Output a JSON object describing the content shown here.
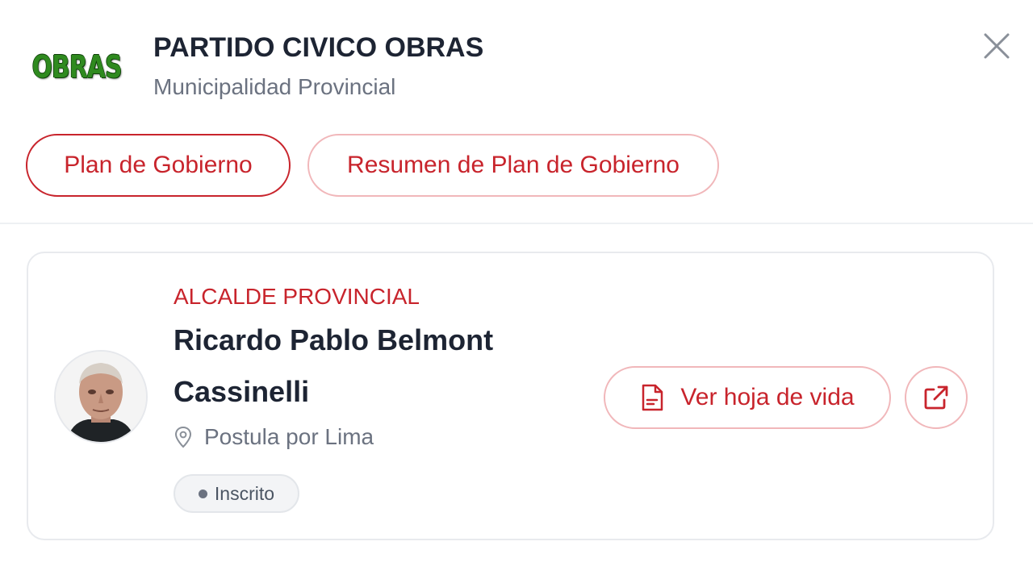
{
  "party": {
    "logo_text": "OBRAS",
    "name": "PARTIDO CIVICO OBRAS",
    "subtitle": "Municipalidad Provincial"
  },
  "actions": {
    "plan_label": "Plan de Gobierno",
    "summary_label": "Resumen de Plan de Gobierno"
  },
  "candidate": {
    "role": "ALCALDE PROVINCIAL",
    "name": "Ricardo Pablo Belmont Cassinelli",
    "location": "Postula por Lima",
    "status": "Inscrito",
    "cv_label": "Ver hoja de vida"
  },
  "colors": {
    "accent": "#c8242c",
    "accent_border": "#f1b7ba",
    "logo_green": "#2f8a1f",
    "text_dark": "#1d2433",
    "text_muted": "#6b7280"
  },
  "icons": {
    "close": "close-icon",
    "location": "map-pin-icon",
    "document": "document-icon",
    "external": "external-link-icon"
  }
}
